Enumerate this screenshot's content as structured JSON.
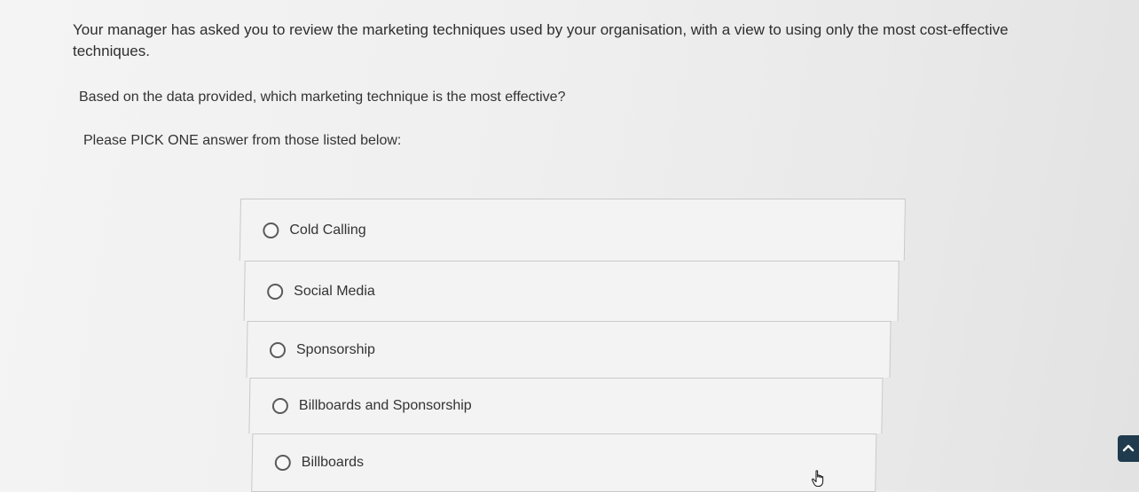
{
  "question": {
    "intro": "Your manager has asked you to review the marketing techniques used by your organisation, with a view to using only the most cost-effective techniques.",
    "prompt": "Based on the data provided, which marketing technique is the most effective?",
    "instruction": "Please PICK ONE answer from those listed below:"
  },
  "options": [
    {
      "label": "Cold Calling",
      "selected": false
    },
    {
      "label": "Social Media",
      "selected": false
    },
    {
      "label": "Sponsorship",
      "selected": false
    },
    {
      "label": "Billboards and Sponsorship",
      "selected": false
    },
    {
      "label": "Billboards",
      "selected": false
    }
  ],
  "icons": {
    "cursor": "hand-pointer-icon",
    "scroll": "chevron-up-icon"
  },
  "colors": {
    "scroll_button": "#1f3b4d"
  }
}
